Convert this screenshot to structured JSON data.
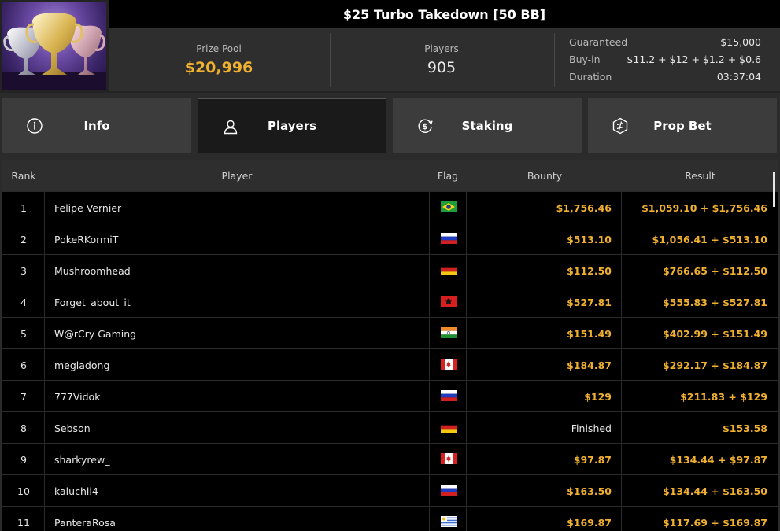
{
  "header": {
    "title": "$25 Turbo Takedown [50 BB]",
    "prize_pool_label": "Prize Pool",
    "prize_pool_value": "$20,996",
    "players_label": "Players",
    "players_value": "905",
    "details": [
      {
        "label": "Guaranteed",
        "value": "$15,000"
      },
      {
        "label": "Buy-in",
        "value": "$11.2 + $12 + $1.2 + $0.6"
      },
      {
        "label": "Duration",
        "value": "03:37:04"
      }
    ]
  },
  "tabs": [
    {
      "label": "Info",
      "icon": "info-icon",
      "active": false
    },
    {
      "label": "Players",
      "icon": "user-icon",
      "active": true
    },
    {
      "label": "Staking",
      "icon": "dollar-refresh-icon",
      "active": false
    },
    {
      "label": "Prop Bet",
      "icon": "prop-bet-icon",
      "active": false
    }
  ],
  "table": {
    "headers": {
      "rank": "Rank",
      "player": "Player",
      "flag": "Flag",
      "bounty": "Bounty",
      "result": "Result"
    },
    "rows": [
      {
        "rank": "1",
        "player": "Felipe Vernier",
        "flag": "BR",
        "bounty": "$1,756.46",
        "result": "$1,059.10 + $1,756.46"
      },
      {
        "rank": "2",
        "player": "PokeRKormiT",
        "flag": "RU",
        "bounty": "$513.10",
        "result": "$1,056.41 + $513.10"
      },
      {
        "rank": "3",
        "player": "Mushroomhead",
        "flag": "DE",
        "bounty": "$112.50",
        "result": "$766.65 + $112.50"
      },
      {
        "rank": "4",
        "player": "Forget_about_it",
        "flag": "AL",
        "bounty": "$527.81",
        "result": "$555.83 + $527.81"
      },
      {
        "rank": "5",
        "player": "W@rCry Gaming",
        "flag": "IN",
        "bounty": "$151.49",
        "result": "$402.99 + $151.49"
      },
      {
        "rank": "6",
        "player": "megladong",
        "flag": "CA",
        "bounty": "$184.87",
        "result": "$292.17 + $184.87"
      },
      {
        "rank": "7",
        "player": "777Vidok",
        "flag": "RU",
        "bounty": "$129",
        "result": "$211.83 + $129"
      },
      {
        "rank": "8",
        "player": "Sebson",
        "flag": "DE",
        "bounty": "Finished",
        "result": "$153.58"
      },
      {
        "rank": "9",
        "player": "sharkyrew_",
        "flag": "CA",
        "bounty": "$97.87",
        "result": "$134.44 + $97.87"
      },
      {
        "rank": "10",
        "player": "kaluchii4",
        "flag": "RU",
        "bounty": "$163.50",
        "result": "$134.44 + $163.50"
      },
      {
        "rank": "11",
        "player": "PanteraRosa",
        "flag": "UY",
        "bounty": "$169.87",
        "result": "$117.69 + $169.87"
      }
    ]
  },
  "colors": {
    "accent_gold": "#f0b030",
    "background": "#2b2b2b",
    "table_bg": "#000000"
  }
}
